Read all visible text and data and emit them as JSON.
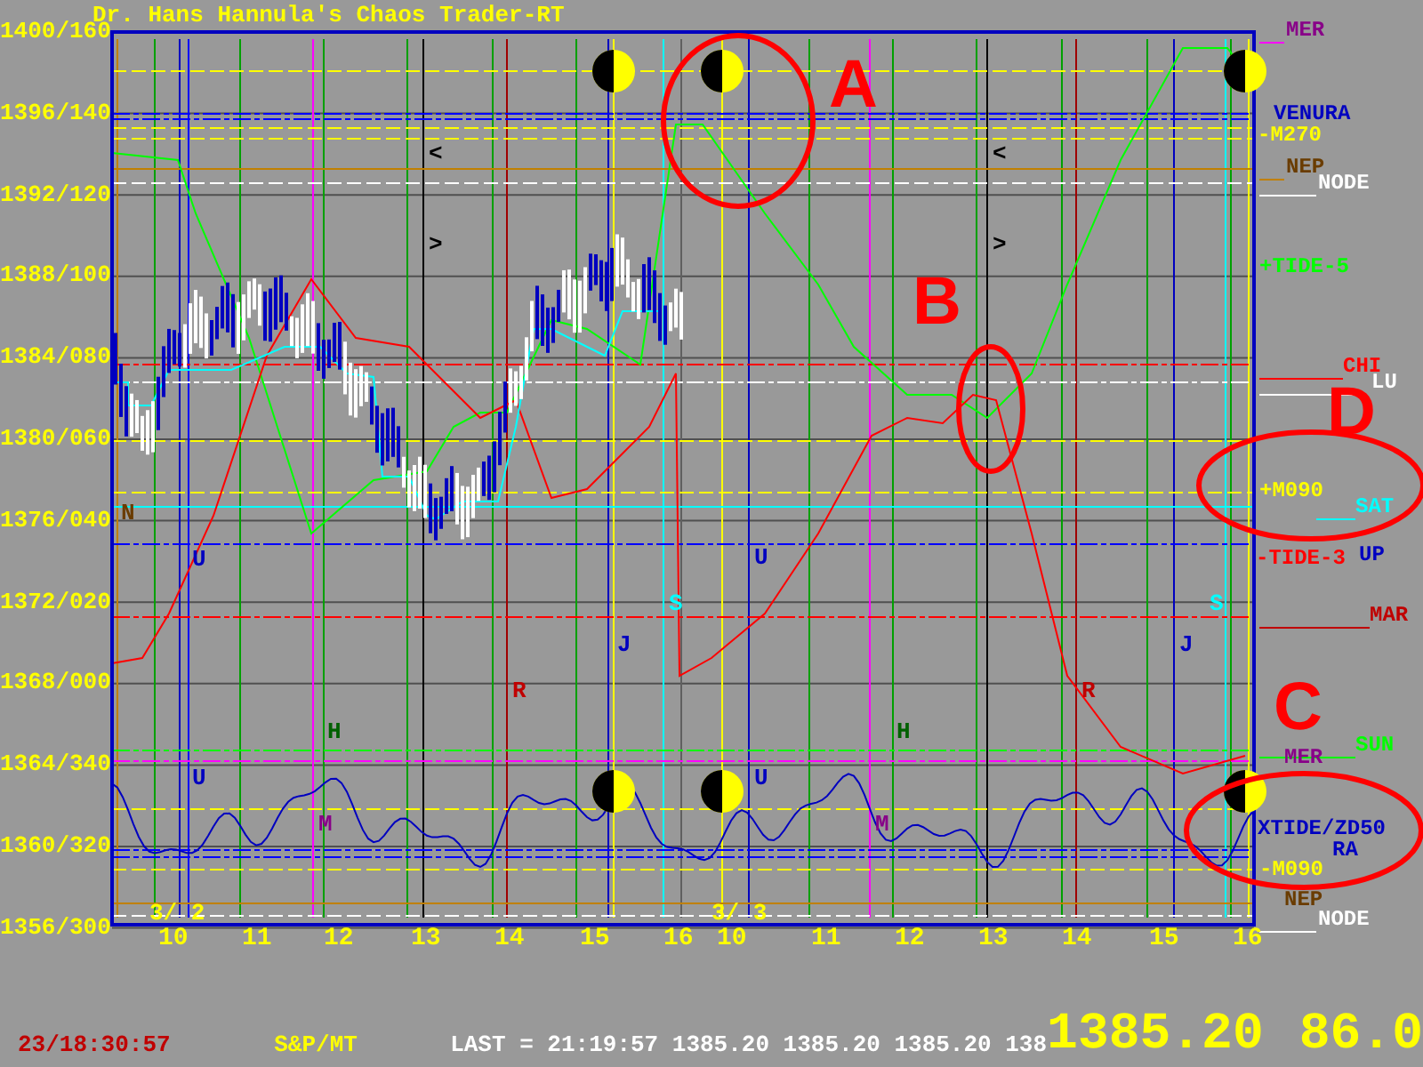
{
  "title": "Dr. Hans Hannula's Chaos Trader-RT",
  "y_axis": {
    "labels": [
      "1400/160",
      "1396/140",
      "1392/120",
      "1388/100",
      "1384/080",
      "1380/060",
      "1376/040",
      "1372/020",
      "1368/000",
      "1364/340",
      "1360/320",
      "1356/300"
    ]
  },
  "x_axis": {
    "labels": [
      "10",
      "11",
      "12",
      "13",
      "14",
      "15",
      "16",
      "10",
      "11",
      "12",
      "13",
      "14",
      "15",
      "16"
    ]
  },
  "plot_labels": [
    {
      "text": "<",
      "color": "#000000"
    },
    {
      "text": ">",
      "color": "#000000"
    },
    {
      "text": "<",
      "color": "#000000"
    },
    {
      "text": ">",
      "color": "#000000"
    },
    {
      "text": "U",
      "color": "#0000c0"
    },
    {
      "text": "U",
      "color": "#0000c0"
    },
    {
      "text": "H",
      "color": "#006000"
    },
    {
      "text": "M",
      "color": "#880088"
    },
    {
      "text": "R",
      "color": "#c00000"
    },
    {
      "text": "J",
      "color": "#0000c0"
    },
    {
      "text": "S",
      "color": "#00ffff"
    },
    {
      "text": "U",
      "color": "#0000c0"
    },
    {
      "text": "U",
      "color": "#0000c0"
    },
    {
      "text": "H",
      "color": "#006000"
    },
    {
      "text": "M",
      "color": "#880088"
    },
    {
      "text": "R",
      "color": "#c00000"
    },
    {
      "text": "J",
      "color": "#0000c0"
    },
    {
      "text": "S",
      "color": "#00ffff"
    },
    {
      "text": "N",
      "color": "#6a3c00"
    },
    {
      "text": "3/ 2",
      "color": "#ffff00"
    },
    {
      "text": "3/ 3",
      "color": "#ffff00"
    }
  ],
  "right_labels": [
    {
      "text": "MER",
      "color": "#880088"
    },
    {
      "text": "VENURA",
      "color": "#0000c0"
    },
    {
      "text": "-M270",
      "color": "#ffff00"
    },
    {
      "text": "NEP",
      "color": "#6a3c00"
    },
    {
      "text": "NODE",
      "color": "#ffffff"
    },
    {
      "text": "+TIDE-5",
      "color": "#00ff00"
    },
    {
      "text": "CHI",
      "color": "#ff0000"
    },
    {
      "text": "LU",
      "color": "#ffffff"
    },
    {
      "text": "+M090",
      "color": "#ffff00"
    },
    {
      "text": "SAT",
      "color": "#00ffff"
    },
    {
      "text": "-TIDE-3",
      "color": "#ff0000"
    },
    {
      "text": "UP",
      "color": "#0000c0"
    },
    {
      "text": "MAR",
      "color": "#c00000"
    },
    {
      "text": "SUN",
      "color": "#00ff00"
    },
    {
      "text": "MER",
      "color": "#880088"
    },
    {
      "text": "XTIDE/ZD50",
      "color": "#0000c0"
    },
    {
      "text": "RA",
      "color": "#0000c0"
    },
    {
      "text": "-M090",
      "color": "#ffff00"
    },
    {
      "text": "NEP",
      "color": "#6a3c00"
    },
    {
      "text": "NODE",
      "color": "#ffffff"
    }
  ],
  "annotations": [
    "A",
    "B",
    "C",
    "D"
  ],
  "status_bar": {
    "timestamp": "23/18:30:57",
    "symbol": "S&P/MT",
    "last": "LAST = 21:19:57 1385.20 1385.20 1385.20 138",
    "price": "1385.20",
    "change": "86.0"
  }
}
